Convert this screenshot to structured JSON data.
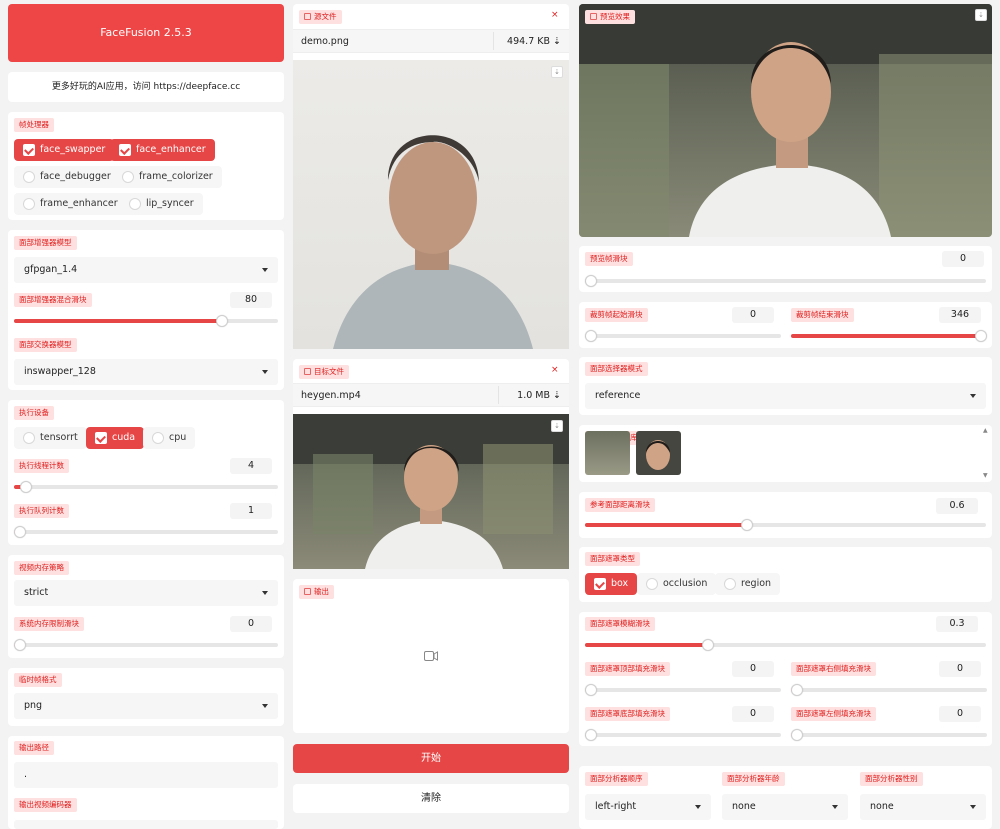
{
  "app_title": "FaceFusion 2.5.3",
  "promo_text": "更多好玩的AI应用，访问 https://deepface.cc",
  "processors": {
    "label": "帧处理器",
    "items": [
      {
        "label": "face_swapper",
        "checked": true
      },
      {
        "label": "face_enhancer",
        "checked": true
      },
      {
        "label": "face_debugger",
        "checked": false
      },
      {
        "label": "frame_colorizer",
        "checked": false
      },
      {
        "label": "frame_enhancer",
        "checked": false
      },
      {
        "label": "lip_syncer",
        "checked": false
      }
    ]
  },
  "face_enhancer_model": {
    "label": "面部增强器模型",
    "value": "gfpgan_1.4"
  },
  "face_enhancer_blend": {
    "label": "面部增强器混合滑块",
    "value": 80,
    "min": 0,
    "max": 100
  },
  "face_swapper_model": {
    "label": "面部交换器模型",
    "value": "inswapper_128"
  },
  "execution_providers": {
    "label": "执行设备",
    "items": [
      {
        "label": "tensorrt",
        "checked": false
      },
      {
        "label": "cuda",
        "checked": true
      },
      {
        "label": "cpu",
        "checked": false
      }
    ]
  },
  "thread_count": {
    "label": "执行线程计数",
    "value": 4,
    "min": 1,
    "max": 128
  },
  "queue_count": {
    "label": "执行队列计数",
    "value": 1,
    "min": 1,
    "max": 32
  },
  "video_memory_strategy": {
    "label": "视频内存策略",
    "value": "strict"
  },
  "system_memory_limit": {
    "label": "系统内存限制滑块",
    "value": 0,
    "min": 0,
    "max": 128
  },
  "temp_frame_format": {
    "label": "临时帧格式",
    "value": "png"
  },
  "output_path": {
    "label": "输出路径",
    "value": "."
  },
  "output_video_encoder": {
    "label": "输出视频编码器"
  },
  "source": {
    "label": "源文件",
    "filename": "demo.png",
    "size": "494.7 KB ⇣"
  },
  "target": {
    "label": "目标文件",
    "filename": "heygen.mp4",
    "size": "1.0 MB ⇣"
  },
  "output": {
    "label": "输出"
  },
  "start_button": "开始",
  "clear_button": "清除",
  "preview": {
    "label": "预览效果"
  },
  "preview_frame": {
    "label": "预览帧滑块",
    "value": 0,
    "min": 0,
    "max": 346
  },
  "trim_start": {
    "label": "裁剪帧起始滑块",
    "value": 0,
    "min": 0,
    "max": 346
  },
  "trim_end": {
    "label": "裁剪帧结束滑块",
    "value": 346,
    "min": 0,
    "max": 346
  },
  "face_selector_mode": {
    "label": "面部选择器模式",
    "value": "reference"
  },
  "reference_gallery": {
    "label": "参考面部库"
  },
  "reference_distance": {
    "label": "参考面部距离滑块",
    "value": 0.6,
    "min": 0,
    "max": 1.5
  },
  "mask_types": {
    "label": "面部遮罩类型",
    "items": [
      {
        "label": "box",
        "checked": true
      },
      {
        "label": "occlusion",
        "checked": false
      },
      {
        "label": "region",
        "checked": false
      }
    ]
  },
  "mask_blur": {
    "label": "面部遮罩模糊滑块",
    "value": 0.3,
    "min": 0,
    "max": 1
  },
  "mask_padding_top": {
    "label": "面部遮罩顶部填充滑块",
    "value": 0,
    "min": 0,
    "max": 100
  },
  "mask_padding_right": {
    "label": "面部遮罩右侧填充滑块",
    "value": 0,
    "min": 0,
    "max": 100
  },
  "mask_padding_bottom": {
    "label": "面部遮罩底部填充滑块",
    "value": 0,
    "min": 0,
    "max": 100
  },
  "mask_padding_left": {
    "label": "面部遮罩左侧填充滑块",
    "value": 0,
    "min": 0,
    "max": 100
  },
  "analyser_order": {
    "label": "面部分析器顺序",
    "value": "left-right"
  },
  "analyser_age": {
    "label": "面部分析器年龄",
    "value": "none"
  },
  "analyser_gender": {
    "label": "面部分析器性别",
    "value": "none"
  },
  "colors": {
    "accent": "#e74646",
    "tag_bg": "#fde0df",
    "tag_fg": "#e02020"
  }
}
